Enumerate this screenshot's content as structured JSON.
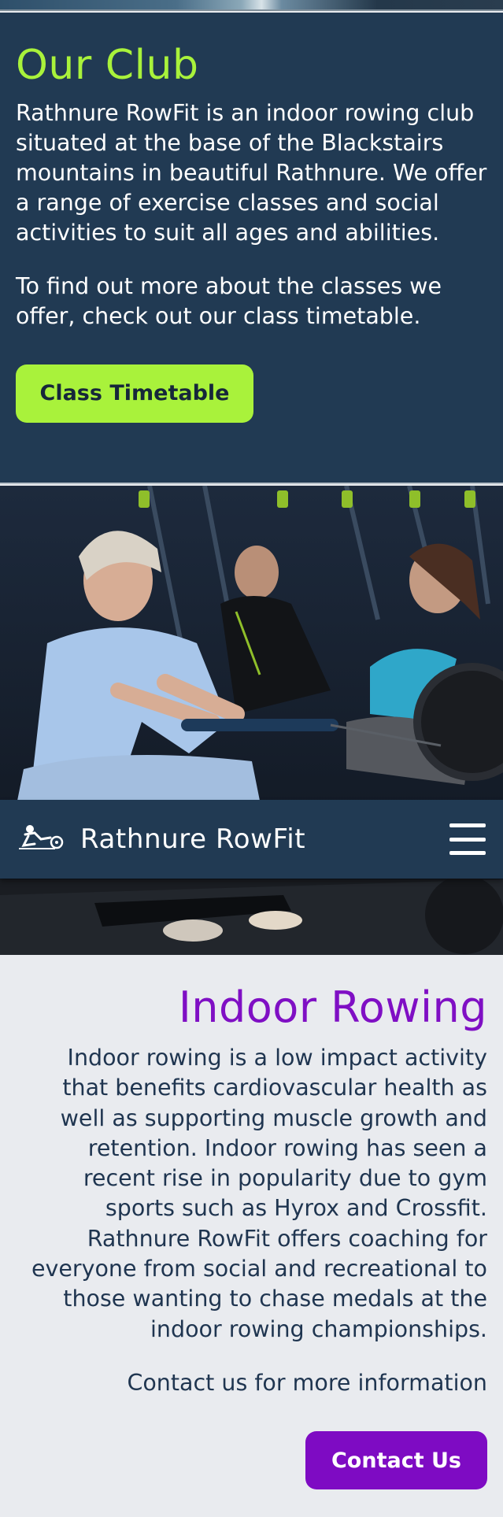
{
  "our_club": {
    "title": "Our Club",
    "paragraph1": "Rathnure RowFit is an indoor rowing club situated at the base of the Blackstairs mountains in beautiful Rathnure. We offer a range of exercise classes and social activities to suit all ages and abilities.",
    "paragraph2": "To find out more about the classes we offer, check out our class timetable.",
    "button_label": "Class Timetable"
  },
  "navbar": {
    "brand": "Rathnure RowFit",
    "logo_icon": "rower-icon",
    "menu_icon": "hamburger-menu-icon"
  },
  "indoor_rowing": {
    "title": "Indoor Rowing",
    "paragraph": "Indoor rowing is a low impact activity that benefits cardiovascular health as well as supporting muscle growth and retention. Indoor rowing has seen a recent rise in popularity due to gym sports such as Hyrox and Crossfit. Rathnure RowFit offers coaching for everyone from social and recreational to those wanting to chase medals at the indoor rowing championships.",
    "contact_text": "Contact us for more information",
    "button_label": "Contact Us"
  },
  "colors": {
    "navy": "#213a53",
    "lime_accent": "#a9f23b",
    "purple_accent": "#7e0bc3",
    "light_bg": "#e9ebef"
  }
}
